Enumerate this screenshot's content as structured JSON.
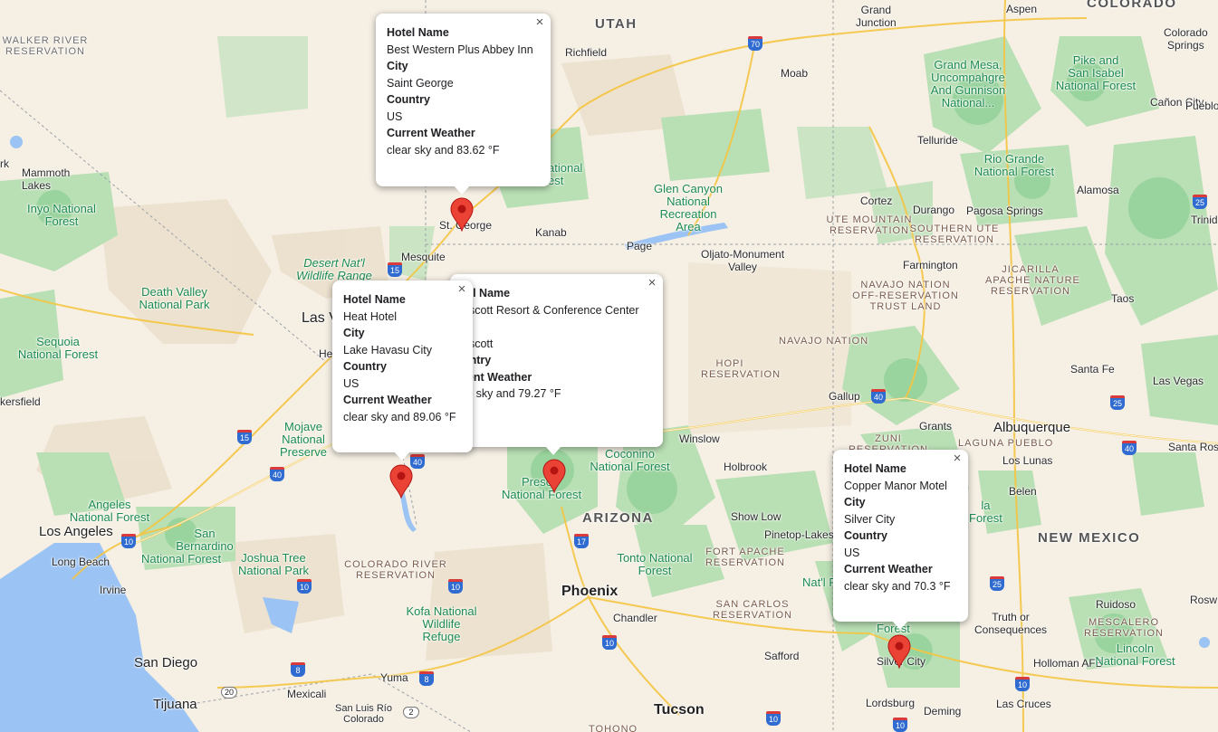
{
  "map": {
    "states": [
      "UTAH",
      "COLORADO",
      "ARIZONA",
      "NEW MEXICO"
    ],
    "cities": {
      "st_george": "St. George",
      "mesquite": "Mesquite",
      "kanab": "Kanab",
      "page": "Page",
      "richfield": "Richfield",
      "moab": "Moab",
      "grand_junction": "Grand\nJunction",
      "aspen": "Aspen",
      "colorado_springs": "Colorado\nSprings",
      "canon_city": "Cañon City",
      "pueblo": "Pueblo",
      "telluride": "Telluride",
      "cortez": "Cortez",
      "durango": "Durango",
      "pagosa": "Pagosa Springs",
      "alamosa": "Alamosa",
      "trinidad": "Trinid",
      "farmington": "Farmington",
      "taos": "Taos",
      "santa_fe": "Santa Fe",
      "las_vegas_nm": "Las Vegas",
      "gallup": "Gallup",
      "grants": "Grants",
      "albuquerque": "Albuquerque",
      "santa_rosa": "Santa Ros",
      "los_lunas": "Los Lunas",
      "belen": "Belen",
      "winslow": "Winslow",
      "holbrook": "Holbrook",
      "show_low": "Show Low",
      "pinetop": "Pinetop-Lakes",
      "phoenix": "Phoenix",
      "chandler": "Chandler",
      "tucson": "Tucson",
      "safford": "Safford",
      "silver_city": "Silver City",
      "lordsburg": "Lordsburg",
      "deming": "Deming",
      "las_cruces": "Las Cruces",
      "holloman": "Holloman AFB",
      "ruidoso": "Ruidoso",
      "truth": "Truth or\nConsequences",
      "roswell": "Rosw",
      "oljato": "Oljato-Monument\nValley",
      "las_vegas": "Las V",
      "henderson": "He",
      "bakersfield": "kersfield",
      "mammoth": "Mammoth\nLakes",
      "los_angeles": "Los Angeles",
      "long_beach": "Long Beach",
      "irvine": "Irvine",
      "san_bernardino": "San\nBernardino",
      "san_diego": "San Diego",
      "tijuana": "Tijuana",
      "mexicali": "Mexicali",
      "yuma": "Yuma",
      "san_luis": "San Luis Río\nColorado",
      "prescott": "Presc",
      "k": "rk"
    },
    "parks": {
      "glen_canyon": "Glen Canyon\nNational\nRecreation\nArea",
      "desert_natl": "Desert Nat'l\nWildlife Range",
      "death_valley": "Death Valley\nNational Park",
      "sequoia": "Sequoia\nNational Forest",
      "inyo": "Inyo National\nForest",
      "mojave": "Mojave\nNational\nPreserve",
      "angeles": "Angeles\nNational Forest",
      "sb_forest": "National Forest",
      "joshua": "Joshua Tree\nNational Park",
      "kofa": "Kofa National\nWildlife\nRefuge",
      "coconino": "Coconino\nNational Forest",
      "prescott_nf": "National Forest",
      "tonto": "Tonto National\nForest",
      "gmug": "Grand Mesa,\nUncompahgre\nAnd Gunnison\nNational...",
      "pike": "Pike and\nSan Isabel\nNational Forest",
      "rio_grande": "Rio Grande\nNational Forest",
      "lincoln": "Lincoln\nNational Forest",
      "cibola_frag": "la\nForest",
      "gila_frag": "Nat'l F",
      "forest_frag": "Forest",
      "dixie_frag": "ational\nest"
    },
    "reservations": {
      "walker": "WALKER RIVER\nRESERVATION",
      "ute": "UTE MOUNTAIN\nRESERVATION",
      "southern_ute": "SOUTHERN UTE\nRESERVATION",
      "jicarilla": "JICARILLA\nAPACHE NATURE\nRESERVATION",
      "navajo_trust": "NAVAJO NATION\nOFF-RESERVATION\nTRUST LAND",
      "navajo": "NAVAJO NATION",
      "hopi": "HOPI\nRESERVATION",
      "zuni": "ZUNI\nRESERVATION",
      "laguna": "LAGUNA PUEBLO",
      "colorado_river": "COLORADO RIVER\nRESERVATION",
      "fort_apache": "FORT APACHE\nRESERVATION",
      "san_carlos": "SAN CARLOS\nRESERVATION",
      "mescalero": "MESCALERO\nRESERVATION",
      "tohono": "TOHONO"
    },
    "shields": [
      "70",
      "15",
      "40",
      "40",
      "25",
      "25",
      "40",
      "10",
      "10",
      "17",
      "10",
      "8",
      "8",
      "25",
      "10",
      "10",
      "10",
      "10",
      "40",
      "15",
      "2",
      "20"
    ]
  },
  "markers": [
    {
      "name": "St. George marker"
    },
    {
      "name": "Lake Havasu City marker"
    },
    {
      "name": "Prescott marker"
    },
    {
      "name": "Silver City marker"
    }
  ],
  "info_windows": [
    {
      "labels": {
        "hotel": "Hotel Name",
        "city": "City",
        "country": "Country",
        "weather": "Current Weather"
      },
      "hotel_name": "Best Western Plus Abbey Inn",
      "city": "Saint George",
      "country": "US",
      "weather": "clear sky and 83.62 °F",
      "close": "×"
    },
    {
      "labels": {
        "hotel": "tel Name",
        "city": "y",
        "country": "untry",
        "weather": "rent Weather"
      },
      "hotel_name": "escott Resort & Conference Center",
      "city": "escott",
      "country": "",
      "weather": "ar sky and 79.27 °F",
      "close": "×"
    },
    {
      "labels": {
        "hotel": "Hotel Name",
        "city": "City",
        "country": "Country",
        "weather": "Current Weather"
      },
      "hotel_name": "Heat Hotel",
      "city": "Lake Havasu City",
      "country": "US",
      "weather": "clear sky and 89.06 °F",
      "close": "×"
    },
    {
      "labels": {
        "hotel": "Hotel Name",
        "city": "City",
        "country": "Country",
        "weather": "Current Weather"
      },
      "hotel_name": "Copper Manor Motel",
      "city": "Silver City",
      "country": "US",
      "weather": "clear sky and 70.3 °F",
      "close": "×"
    }
  ],
  "colors": {
    "land": "#f5efe4",
    "forest": "#b9dfb5",
    "forest_dark": "#8fcf96",
    "water": "#9bc3f4",
    "marker": "#ea4335",
    "desert": "#ece0cc"
  }
}
